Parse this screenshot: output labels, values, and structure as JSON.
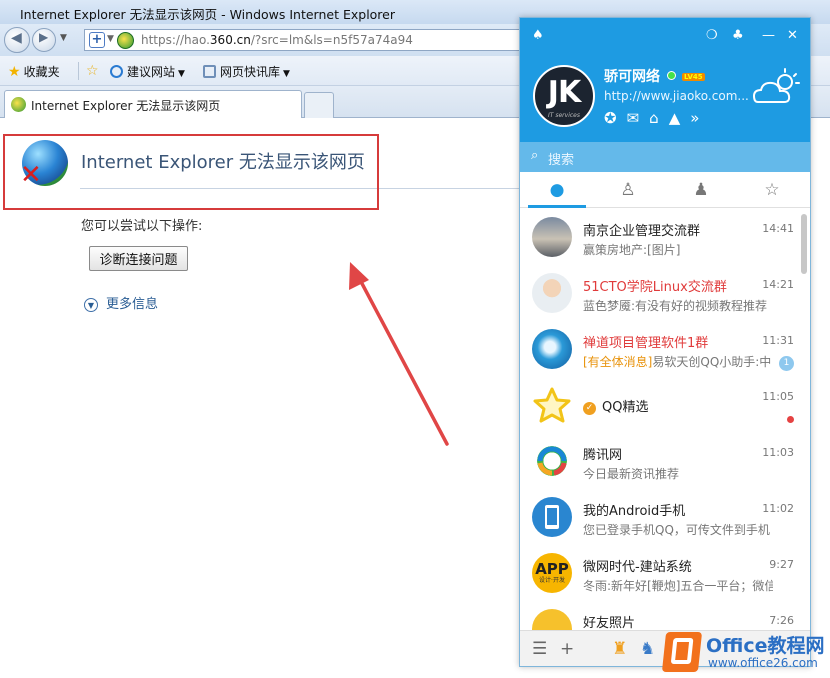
{
  "window": {
    "title": "Internet Explorer 无法显示该网页 - Windows Internet Explorer"
  },
  "address_bar": {
    "url_prefix": "https://hao.",
    "url_domain": "360.cn",
    "url_suffix": "/?src=lm&ls=n5f57a74a94"
  },
  "favorites_bar": {
    "favorites_label": "收藏夹",
    "suggested_sites_label": "建议网站",
    "web_slice_label": "网页快讯库"
  },
  "tab": {
    "label": "Internet Explorer 无法显示该网页"
  },
  "error_page": {
    "title": "Internet Explorer 无法显示该网页",
    "try_text": "您可以尝试以下操作:",
    "diagnose_button": "诊断连接问题",
    "more_info": "更多信息"
  },
  "qq": {
    "avatar_text": "JK",
    "avatar_subtext": "IT services",
    "nickname": "骄可网络",
    "level_badge": "LV45",
    "signature": "http://www.jiaoko.com...",
    "search_placeholder": "搜索",
    "accent_color": "#1e9be2",
    "conversations": [
      {
        "name": "南京企业管理交流群",
        "time": "14:41",
        "message": "赢策房地产:[图片]",
        "name_red": false
      },
      {
        "name": "51CTO学院Linux交流群",
        "time": "14:21",
        "message": "蓝色梦魇:有没有好的视频教程推荐",
        "name_red": true
      },
      {
        "name": "禅道项目管理软件1群",
        "time": "11:31",
        "message_tag": "[有全体消息]",
        "message": "易软天创QQ小助手:中",
        "badge": "1",
        "name_red": true
      },
      {
        "name": "QQ精选",
        "time": "11:05",
        "message": "",
        "name_red": false
      },
      {
        "name": "腾讯网",
        "time": "11:03",
        "message": "今日最新资讯推荐",
        "name_red": false
      },
      {
        "name": "我的Android手机",
        "time": "11:02",
        "message": "您已登录手机QQ，可传文件到手机",
        "name_red": false
      },
      {
        "name": "微网时代-建站系统",
        "time": "9:27",
        "message": "冬雨:新年好[鞭炮]五合一平台；微信小",
        "name_red": false
      },
      {
        "name": "好友照片",
        "time": "7:26",
        "message": "",
        "name_red": false
      }
    ],
    "app_avatar_text": "APP",
    "app_avatar_subtext": "设计·开发"
  },
  "watermark": {
    "title": "Office教程网",
    "url": "www.office26.com"
  }
}
